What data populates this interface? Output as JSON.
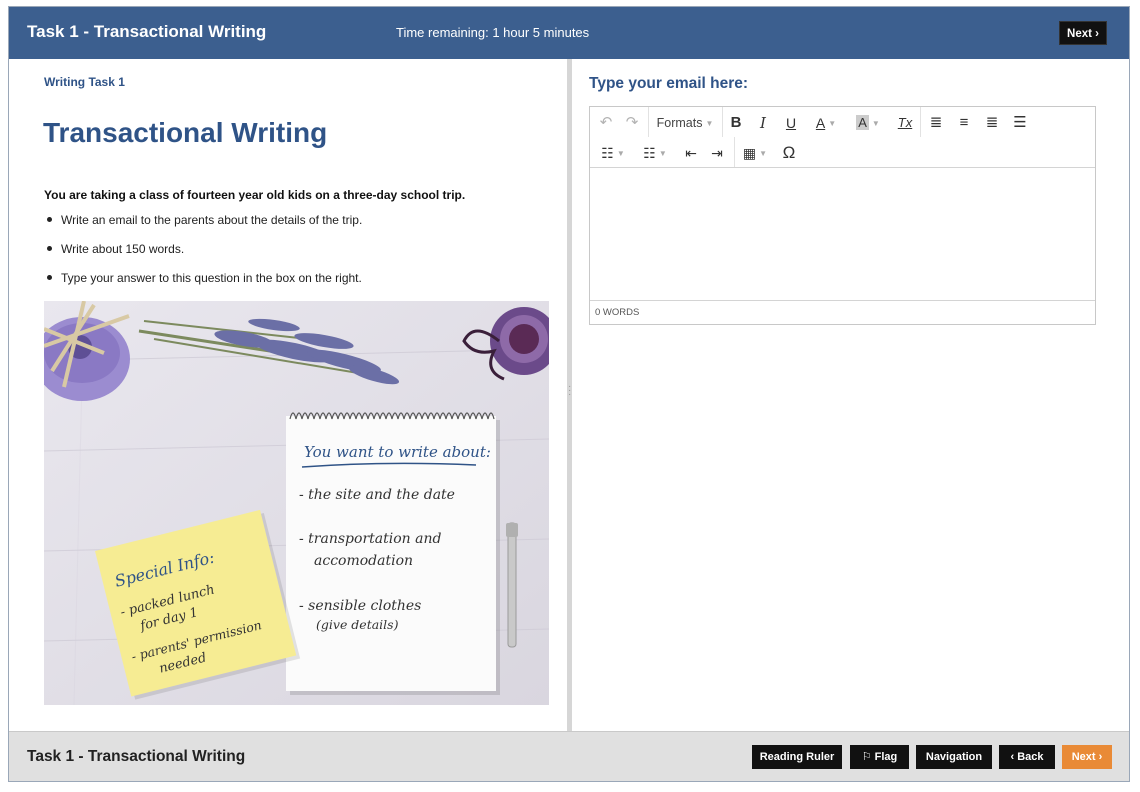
{
  "header": {
    "title": "Task 1 - Transactional Writing",
    "timer": "Time remaining: 1 hour 5 minutes",
    "next_label": "Next ›"
  },
  "left": {
    "subhead": "Writing Task 1",
    "title": "Transactional Writing",
    "intro": "You are taking a class of fourteen year old kids on a three-day school trip.",
    "bullets": [
      "Write an email to the parents about the details of the trip.",
      "Write about 150 words.",
      "Type your answer to this question in the box on the right."
    ],
    "image": {
      "notepad_heading": "You want to write about:",
      "notepad_items": [
        "- the site and the date",
        "- transportation and",
        "accomodation",
        "- sensible clothes",
        "(give details)"
      ],
      "sticky_heading": "Special Info:",
      "sticky_items": [
        "- packed lunch",
        "for day 1",
        "- parents' permission",
        "needed"
      ]
    }
  },
  "right": {
    "label": "Type your email here:",
    "toolbar": {
      "formats_label": "Formats",
      "bold": "B",
      "italic": "I",
      "underline": "U",
      "font_color": "A",
      "bg_color": "A",
      "clear_format": "Tx",
      "omega": "Ω"
    },
    "editor_value": "",
    "word_count": "0 WORDS"
  },
  "footer": {
    "title": "Task 1 - Transactional Writing",
    "reading_ruler": "Reading Ruler",
    "flag": "Flag",
    "navigation": "Navigation",
    "back": "‹ Back",
    "next": "Next ›"
  },
  "colors": {
    "header_bg": "#3c5f8f",
    "title_blue": "#2f5387",
    "next_orange": "#e98a36",
    "footer_bg": "#e0e0e0"
  }
}
